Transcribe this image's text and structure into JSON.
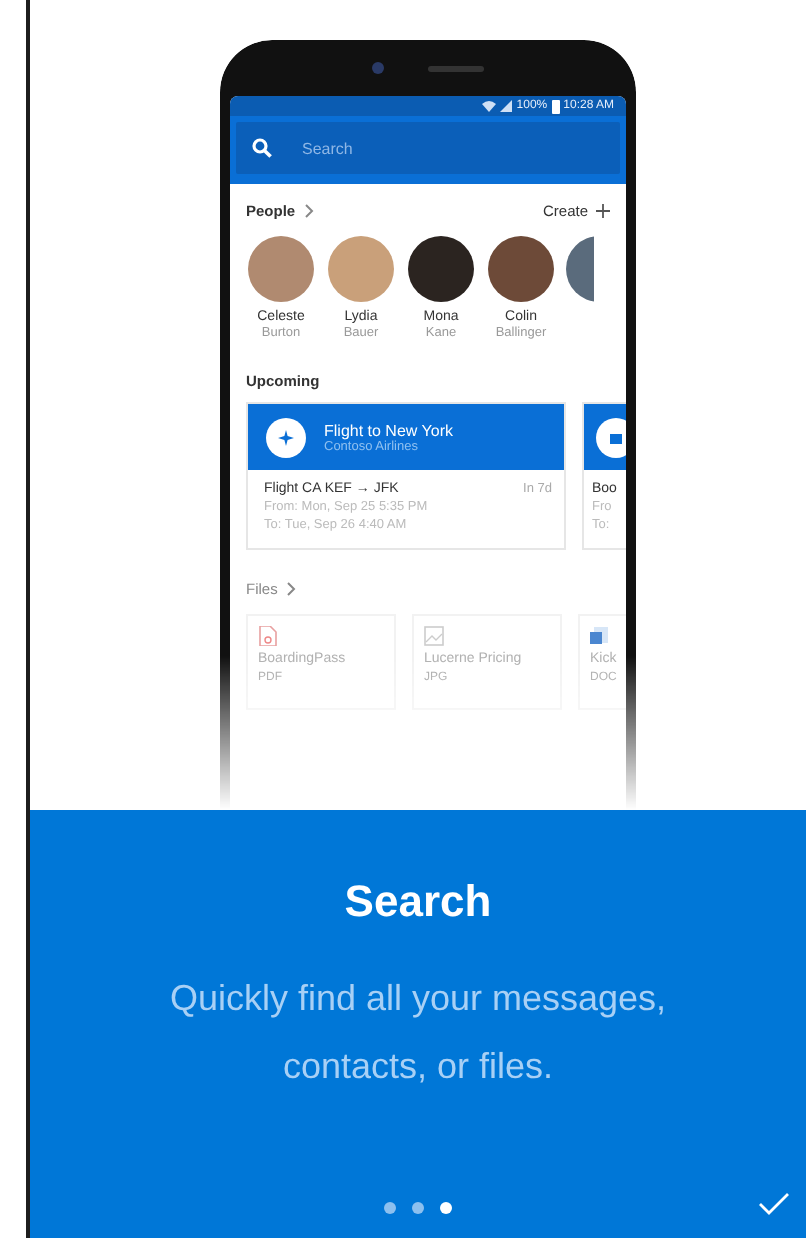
{
  "status_bar": {
    "battery": "100%",
    "time": "10:28 AM"
  },
  "search": {
    "placeholder": "Search"
  },
  "people": {
    "title": "People",
    "action": "Create",
    "contacts": [
      {
        "first": "Celeste",
        "last": "Burton"
      },
      {
        "first": "Lydia",
        "last": "Bauer"
      },
      {
        "first": "Mona",
        "last": "Kane"
      },
      {
        "first": "Colin",
        "last": "Ballinger"
      }
    ]
  },
  "upcoming": {
    "title": "Upcoming",
    "cards": [
      {
        "title": "Flight to New York",
        "subtitle": "Contoso Airlines",
        "detail": "Flight CA KEF → JFK",
        "when": "In 7d",
        "from": "From: Mon, Sep 25 5:35 PM",
        "to": "To: Tue, Sep 26 4:40 AM"
      },
      {
        "detail": "Boo",
        "from": "Fro",
        "to": "To:"
      }
    ]
  },
  "files": {
    "title": "Files",
    "items": [
      {
        "name": "BoardingPass",
        "type": "PDF",
        "kind": "pdf"
      },
      {
        "name": "Lucerne Pricing",
        "type": "JPG",
        "kind": "image"
      },
      {
        "name": "Kick",
        "type": "DOC",
        "kind": "doc"
      }
    ]
  },
  "onboarding": {
    "title": "Search",
    "description": "Quickly find all your messages, contacts, or files.",
    "pages": [
      {
        "selected": false
      },
      {
        "selected": false
      },
      {
        "selected": true
      }
    ]
  }
}
